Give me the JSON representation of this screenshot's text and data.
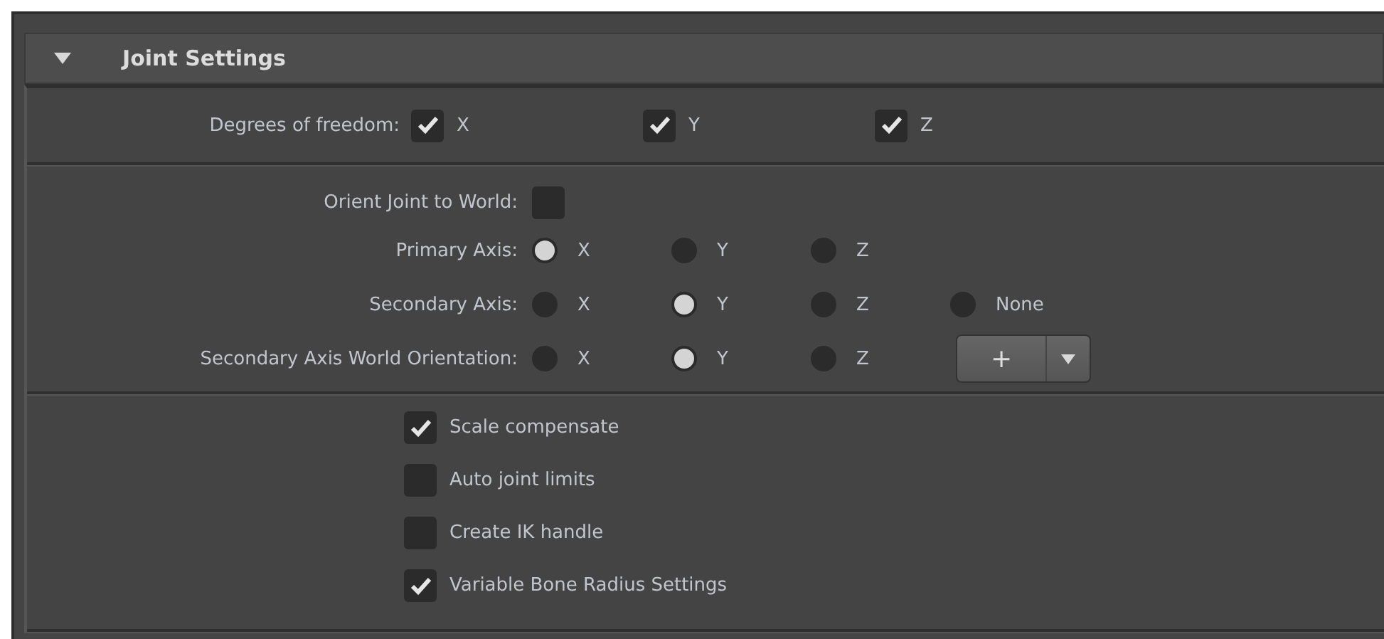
{
  "section": {
    "title": "Joint Settings",
    "expanded": true
  },
  "degrees_of_freedom": {
    "label": "Degrees of freedom:",
    "axes": [
      {
        "label": "X",
        "checked": true
      },
      {
        "label": "Y",
        "checked": true
      },
      {
        "label": "Z",
        "checked": true
      }
    ]
  },
  "orient_joint_to_world": {
    "label": "Orient Joint to World:",
    "checked": false
  },
  "axis_rows": [
    {
      "label": "Primary Axis:",
      "options": [
        {
          "label": "X",
          "selected": true
        },
        {
          "label": "Y",
          "selected": false
        },
        {
          "label": "Z",
          "selected": false
        }
      ]
    },
    {
      "label": "Secondary Axis:",
      "options": [
        {
          "label": "X",
          "selected": false
        },
        {
          "label": "Y",
          "selected": true
        },
        {
          "label": "Z",
          "selected": false
        },
        {
          "label": "None",
          "selected": false
        }
      ]
    },
    {
      "label": "Secondary Axis World Orientation:",
      "options": [
        {
          "label": "X",
          "selected": false
        },
        {
          "label": "Y",
          "selected": true
        },
        {
          "label": "Z",
          "selected": false
        }
      ],
      "button": {
        "label": "+"
      }
    }
  ],
  "options": [
    {
      "label": "Scale compensate",
      "checked": true
    },
    {
      "label": "Auto joint limits",
      "checked": false
    },
    {
      "label": "Create IK handle",
      "checked": false
    },
    {
      "label": "Variable Bone Radius Settings",
      "checked": true
    }
  ]
}
